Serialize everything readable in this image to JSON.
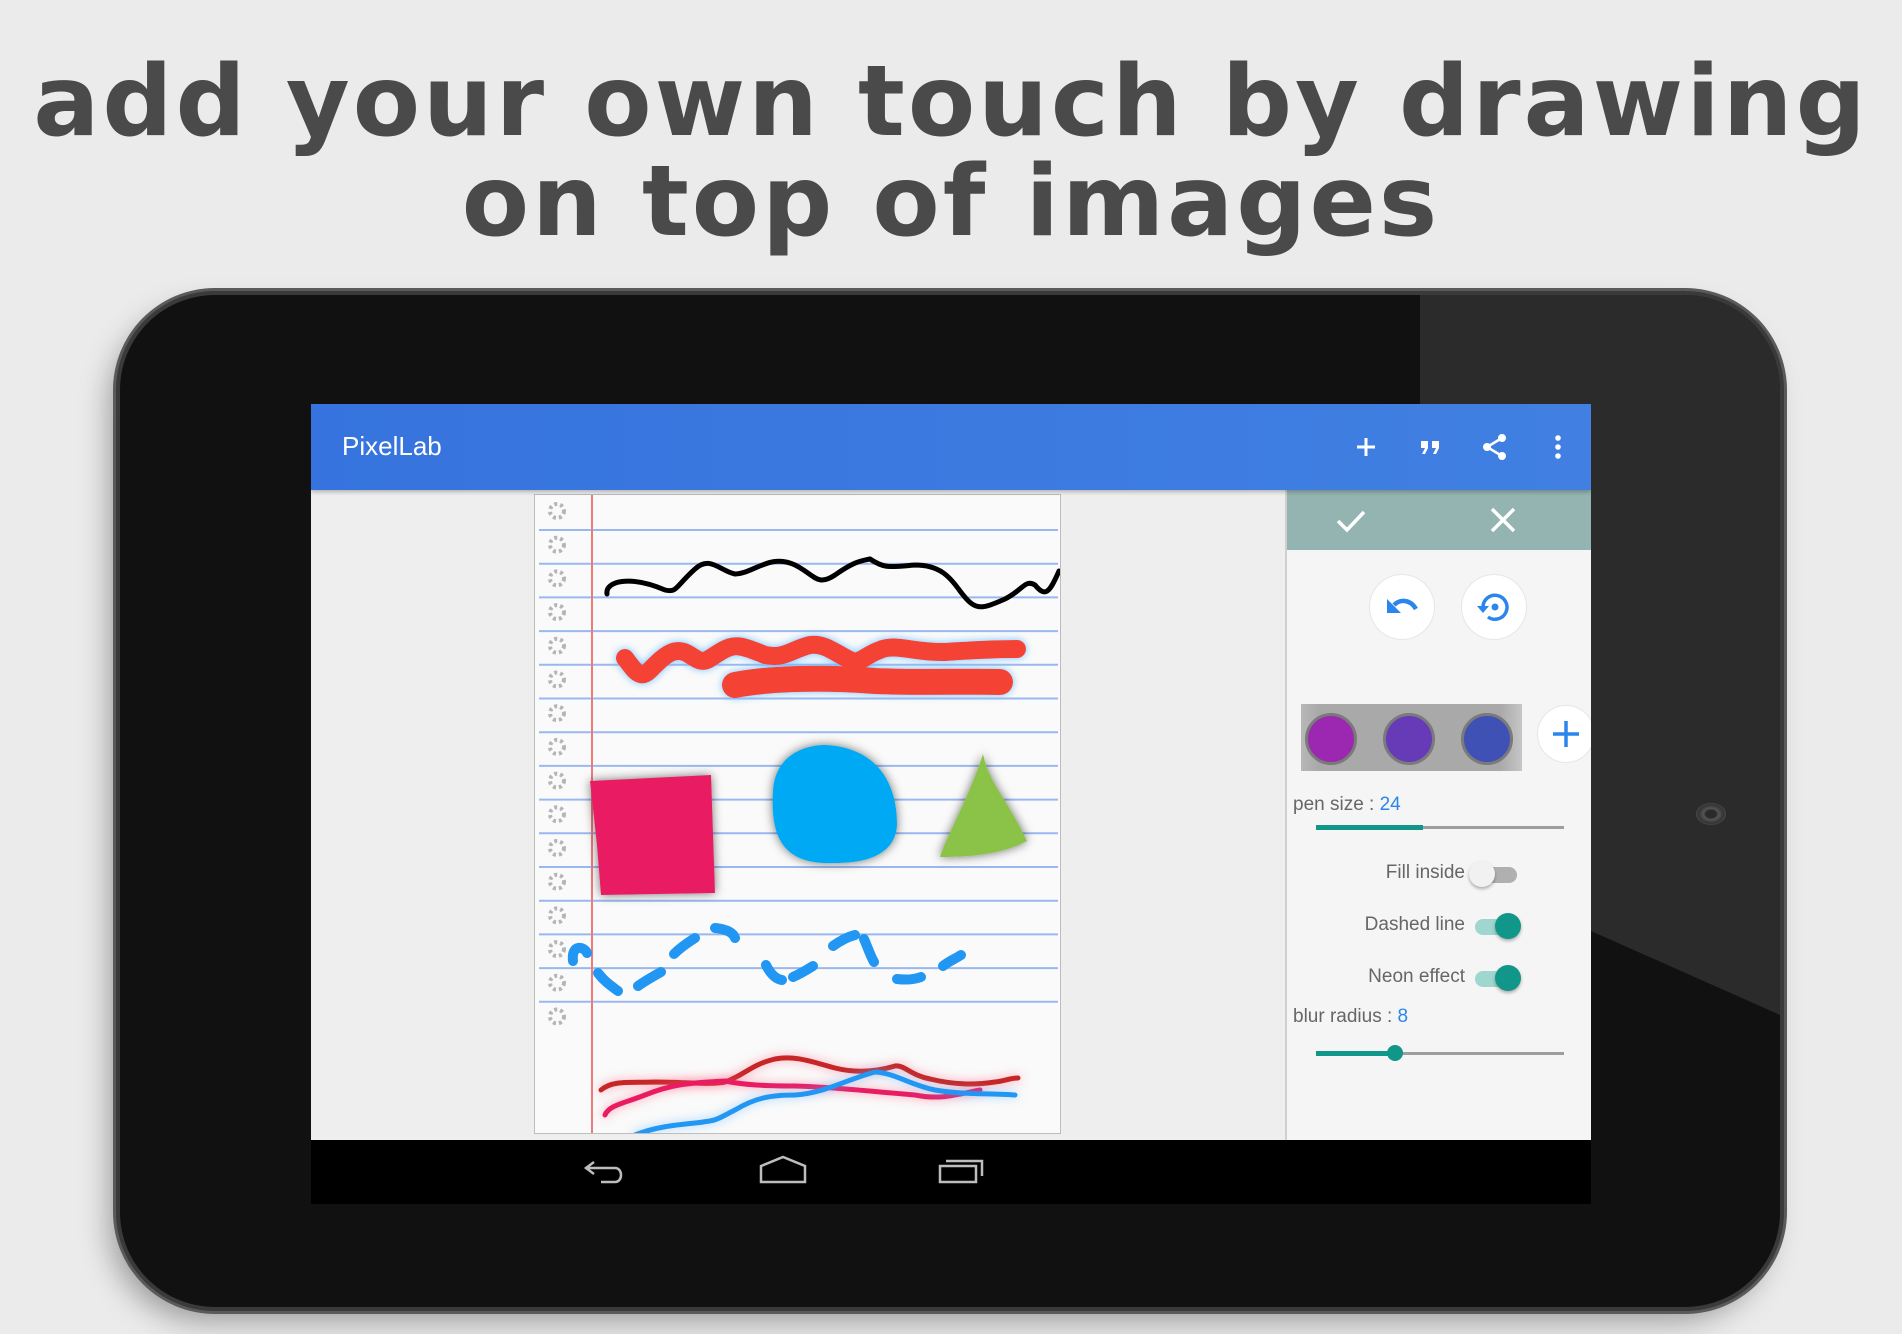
{
  "headline": {
    "line1": "add your own touch by drawing",
    "line2": "on top of images"
  },
  "app": {
    "title": "PixelLab",
    "colors": {
      "appbar": "#3a78e0",
      "panel_header": "#94b4b1",
      "accent": "#11968a",
      "value_blue": "#2a86ec"
    },
    "toolbar": [
      {
        "name": "add",
        "icon": "plus-icon"
      },
      {
        "name": "quote",
        "icon": "quote-icon"
      },
      {
        "name": "share",
        "icon": "share-icon"
      },
      {
        "name": "more",
        "icon": "more-vert-icon"
      }
    ]
  },
  "canvas": {
    "drawings": [
      {
        "type": "freehand-line",
        "color": "#000000"
      },
      {
        "type": "freehand-line",
        "color": "#f44336",
        "effect": "neon-blue-glow"
      },
      {
        "type": "filled-square",
        "color": "#e91e63"
      },
      {
        "type": "filled-circle",
        "color": "#03a9f4"
      },
      {
        "type": "filled-triangle",
        "color": "#8bc34a"
      },
      {
        "type": "dashed-line",
        "color": "#2196f3"
      },
      {
        "type": "neon-line",
        "color": "#c62828"
      },
      {
        "type": "neon-line",
        "color": "#e91e63"
      },
      {
        "type": "neon-line",
        "color": "#2196f3"
      }
    ]
  },
  "panel": {
    "confirm_icon": "check-icon",
    "cancel_icon": "close-icon",
    "undo_icon": "undo-icon",
    "reset_icon": "reset-icon",
    "colors": [
      "#9c27b0",
      "#673ab7",
      "#3f51b5"
    ],
    "add_color_icon": "plus-icon",
    "pen_size": {
      "label": "pen size : ",
      "value": "24",
      "fraction": 0.43
    },
    "toggles": [
      {
        "label": "Fill inside",
        "on": false
      },
      {
        "label": "Dashed line",
        "on": true
      },
      {
        "label": "Neon effect",
        "on": true
      }
    ],
    "blur_radius": {
      "label": "blur radius : ",
      "value": "8",
      "fraction": 0.32
    }
  },
  "navbar": {
    "back_icon": "back-icon",
    "home_icon": "home-icon",
    "recents_icon": "recents-icon"
  }
}
